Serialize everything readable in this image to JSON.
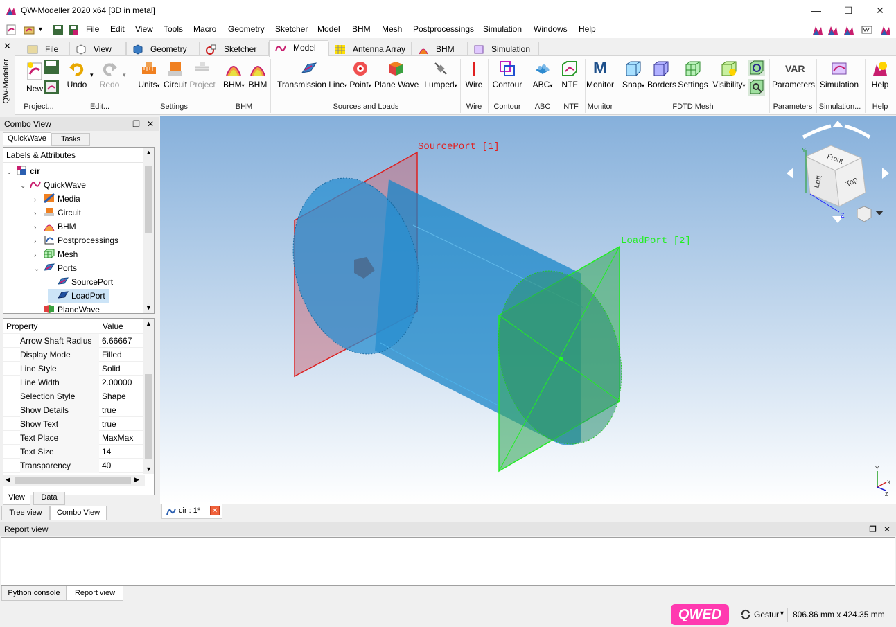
{
  "window": {
    "title": "QW-Modeller 2020 x64 [3D in metal]",
    "minimize": "—",
    "maximize": "☐",
    "close": "✕"
  },
  "menu": [
    "File",
    "Edit",
    "View",
    "Tools",
    "Macro",
    "Geometry",
    "Sketcher",
    "Model",
    "BHM",
    "Mesh",
    "Postprocessings",
    "Simulation",
    "Windows",
    "Help"
  ],
  "side_strip": {
    "close": "✕",
    "label": "QW-Modeller"
  },
  "ribbon_tabs": [
    {
      "label": "File",
      "icon": "file-tab-icon"
    },
    {
      "label": "View",
      "icon": "view-cube-icon"
    },
    {
      "label": "Geometry",
      "icon": "geometry-icon"
    },
    {
      "label": "Sketcher",
      "icon": "sketcher-icon"
    },
    {
      "label": "Model",
      "icon": "model-icon",
      "active": true
    },
    {
      "label": "Antenna Array",
      "icon": "antenna-array-icon"
    },
    {
      "label": "BHM",
      "icon": "bhm-icon"
    },
    {
      "label": "Simulation",
      "icon": "simulation-icon"
    }
  ],
  "ribbon": {
    "new": "New",
    "undo": "Undo",
    "redo": "Redo",
    "units": "Units",
    "circuit": "Circuit",
    "project": "Project",
    "bhm1": "BHM",
    "bhm2": "BHM",
    "transmission_line": "Transmission Line",
    "point": "Point",
    "plane_wave": "Plane Wave",
    "lumped": "Lumped",
    "wire": "Wire",
    "contour": "Contour",
    "abc": "ABC",
    "ntf": "NTF",
    "monitor": "Monitor",
    "snap": "Snap",
    "borders": "Borders",
    "settings": "Settings",
    "visibility": "Visibility",
    "parameters": "Parameters",
    "simulation": "Simulation",
    "help": "Help",
    "var_icon_text": "VAR",
    "monitor_icon_text": "M",
    "dropdown_marker": "▾"
  },
  "ribbon_groups": {
    "project": "Project...",
    "edit": "Edit...",
    "settings": "Settings",
    "bhm": "BHM",
    "sources": "Sources and Loads",
    "wire": "Wire",
    "contour": "Contour",
    "abc": "ABC",
    "ntf": "NTF",
    "monitor": "Monitor",
    "fdtd": "FDTD Mesh",
    "parameters": "Parameters",
    "simulation": "Simulation...",
    "help": "Help"
  },
  "combo": {
    "title": "Combo View",
    "tabs": [
      "QuickWave",
      "Tasks"
    ],
    "tree_header": "Labels & Attributes",
    "tree": [
      {
        "label": "cir",
        "level": 0,
        "arrow": "⌄",
        "bold": true
      },
      {
        "label": "QuickWave",
        "level": 1,
        "arrow": "⌄"
      },
      {
        "label": "Media",
        "level": 2,
        "arrow": "›"
      },
      {
        "label": "Circuit",
        "level": 2,
        "arrow": "›"
      },
      {
        "label": "BHM",
        "level": 2,
        "arrow": "›"
      },
      {
        "label": "Postprocessings",
        "level": 2,
        "arrow": "›"
      },
      {
        "label": "Mesh",
        "level": 2,
        "arrow": "›"
      },
      {
        "label": "Ports",
        "level": 2,
        "arrow": "⌄"
      },
      {
        "label": "SourcePort",
        "level": 3,
        "arrow": ""
      },
      {
        "label": "LoadPort",
        "level": 3,
        "arrow": "",
        "selected": true
      },
      {
        "label": "PlaneWave",
        "level": 2,
        "arrow": ""
      }
    ],
    "prop_header": {
      "name": "Property",
      "value": "Value"
    },
    "properties": [
      {
        "name": "Arrow Shaft Radius",
        "value": "6.66667"
      },
      {
        "name": "Display Mode",
        "value": "Filled"
      },
      {
        "name": "Line Style",
        "value": "Solid"
      },
      {
        "name": "Line Width",
        "value": "2.00000"
      },
      {
        "name": "Selection Style",
        "value": "Shape"
      },
      {
        "name": "Show Details",
        "value": "true"
      },
      {
        "name": "Show Text",
        "value": "true"
      },
      {
        "name": "Text Place",
        "value": "MaxMax"
      },
      {
        "name": "Text Size",
        "value": "14"
      },
      {
        "name": "Transparency",
        "value": "40"
      }
    ],
    "sub_tabs": [
      "View",
      "Data"
    ],
    "bottom_tabs": [
      "Tree view",
      "Combo View"
    ],
    "float_btn": "❐",
    "close_btn": "✕"
  },
  "viewport": {
    "source_label": "SourcePort [1]",
    "load_label": "LoadPort [2]",
    "cube_faces": {
      "top": "Front",
      "left": "Left",
      "right": "Top"
    },
    "axis": {
      "x": "X",
      "y": "Y",
      "z": "Z"
    },
    "colors": {
      "source": "#d22020",
      "load": "#22ee22",
      "cylinder": "#1a86c8"
    }
  },
  "doc_tab": {
    "label": "cir : 1*",
    "close": "✕"
  },
  "report": {
    "title": "Report view",
    "tabs": [
      "Python console",
      "Report view"
    ],
    "float_btn": "❐",
    "close_btn": "✕"
  },
  "status": {
    "nav_style": "Gestur",
    "dimensions": "806.86 mm x 424.35 mm",
    "logo_text": "QWED"
  }
}
